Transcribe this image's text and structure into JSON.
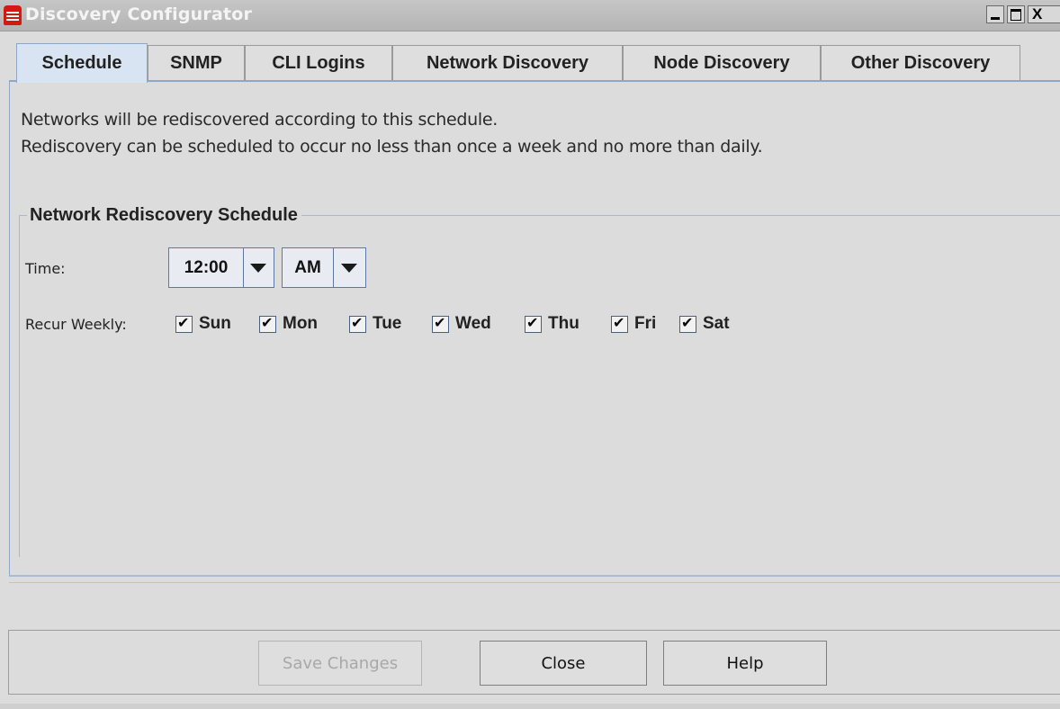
{
  "window": {
    "title": "Discovery Configurator",
    "close_glyph": "X"
  },
  "tabs": [
    {
      "label": "Schedule",
      "active": true
    },
    {
      "label": "SNMP"
    },
    {
      "label": "CLI Logins"
    },
    {
      "label": "Network Discovery"
    },
    {
      "label": "Node Discovery"
    },
    {
      "label": "Other Discovery"
    }
  ],
  "schedule": {
    "description_line1": "Networks will be rediscovered according to this schedule.",
    "description_line2": "Rediscovery can be scheduled to occur no less than once a week and no more than daily.",
    "group_title": "Network Rediscovery Schedule",
    "time_label": "Time:",
    "time_value": "12:00",
    "ampm_value": "AM",
    "recur_label": "Recur Weekly:",
    "days": [
      {
        "label": "Sun",
        "checked": true
      },
      {
        "label": "Mon",
        "checked": true
      },
      {
        "label": "Tue",
        "checked": true
      },
      {
        "label": "Wed",
        "checked": true
      },
      {
        "label": "Thu",
        "checked": true
      },
      {
        "label": "Fri",
        "checked": true
      },
      {
        "label": "Sat",
        "checked": true
      }
    ]
  },
  "buttons": {
    "save": "Save Changes",
    "close": "Close",
    "help": "Help"
  },
  "colors": {
    "active_tab": "#d9e4f2",
    "tab_border": "#8ea6c8",
    "app_icon": "#d21a10"
  }
}
